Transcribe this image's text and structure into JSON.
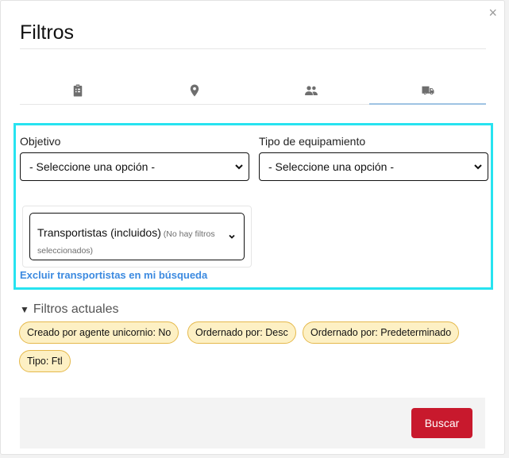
{
  "modal": {
    "title": "Filtros",
    "close_glyph": "×"
  },
  "tabs": [
    {
      "icon": "clipboard-icon",
      "active": false
    },
    {
      "icon": "location-pin-icon",
      "active": false
    },
    {
      "icon": "people-icon",
      "active": false
    },
    {
      "icon": "truck-icon",
      "active": true
    }
  ],
  "fields": {
    "objetivo": {
      "label": "Objetivo",
      "value": "- Seleccione una opción -"
    },
    "tipo_equipamiento": {
      "label": "Tipo de equipamiento",
      "value": "- Seleccione una opción -"
    },
    "transportistas": {
      "label": "Transportistas (incluidos)",
      "hint": "(No hay filtros seleccionados)"
    },
    "exclude_link": "Excluir transportistas en mi búsqueda"
  },
  "current_filters": {
    "toggle_glyph": "▼",
    "label": "Filtros actuales",
    "chips": [
      "Creado por agente unicornio: No",
      "Ordernado por: Desc",
      "Ordernado por: Predeterminado",
      "Tipo: Ftl"
    ]
  },
  "footer": {
    "search_label": "Buscar"
  },
  "colors": {
    "accent_button": "#c8192d",
    "link": "#3c8ae0",
    "chip_bg": "#fdf0c4",
    "chip_border": "#e5b94c",
    "highlight_border": "#27e3f0"
  }
}
